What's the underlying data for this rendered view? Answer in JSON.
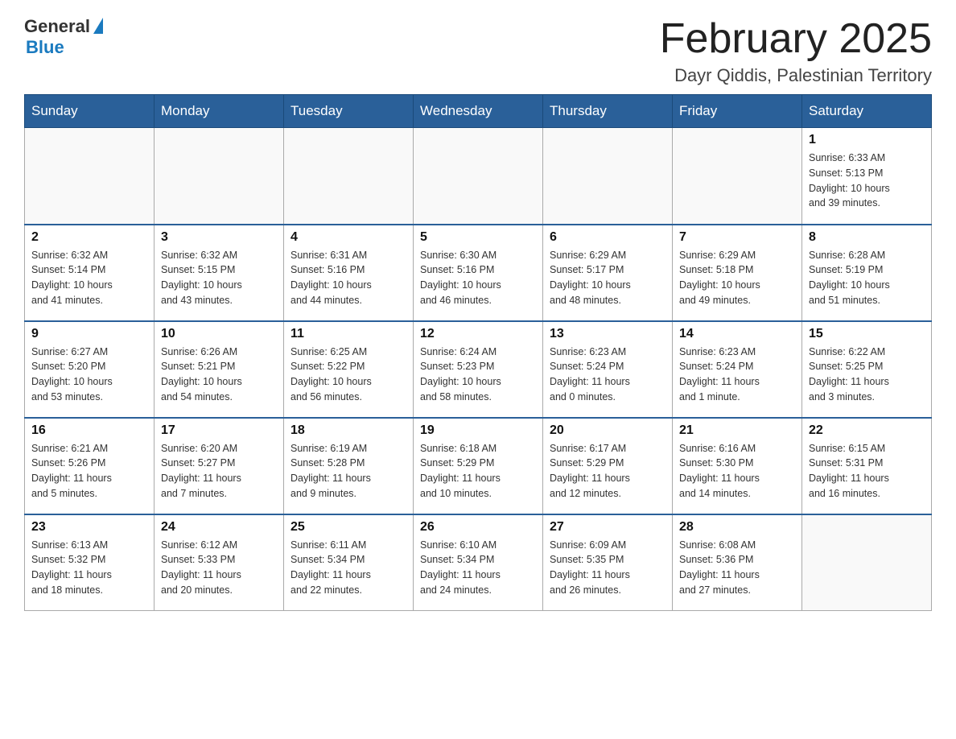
{
  "header": {
    "logo_general": "General",
    "logo_blue": "Blue",
    "month_title": "February 2025",
    "location": "Dayr Qiddis, Palestinian Territory"
  },
  "columns": [
    "Sunday",
    "Monday",
    "Tuesday",
    "Wednesday",
    "Thursday",
    "Friday",
    "Saturday"
  ],
  "weeks": [
    {
      "days": [
        {
          "number": "",
          "info": ""
        },
        {
          "number": "",
          "info": ""
        },
        {
          "number": "",
          "info": ""
        },
        {
          "number": "",
          "info": ""
        },
        {
          "number": "",
          "info": ""
        },
        {
          "number": "",
          "info": ""
        },
        {
          "number": "1",
          "info": "Sunrise: 6:33 AM\nSunset: 5:13 PM\nDaylight: 10 hours\nand 39 minutes."
        }
      ]
    },
    {
      "days": [
        {
          "number": "2",
          "info": "Sunrise: 6:32 AM\nSunset: 5:14 PM\nDaylight: 10 hours\nand 41 minutes."
        },
        {
          "number": "3",
          "info": "Sunrise: 6:32 AM\nSunset: 5:15 PM\nDaylight: 10 hours\nand 43 minutes."
        },
        {
          "number": "4",
          "info": "Sunrise: 6:31 AM\nSunset: 5:16 PM\nDaylight: 10 hours\nand 44 minutes."
        },
        {
          "number": "5",
          "info": "Sunrise: 6:30 AM\nSunset: 5:16 PM\nDaylight: 10 hours\nand 46 minutes."
        },
        {
          "number": "6",
          "info": "Sunrise: 6:29 AM\nSunset: 5:17 PM\nDaylight: 10 hours\nand 48 minutes."
        },
        {
          "number": "7",
          "info": "Sunrise: 6:29 AM\nSunset: 5:18 PM\nDaylight: 10 hours\nand 49 minutes."
        },
        {
          "number": "8",
          "info": "Sunrise: 6:28 AM\nSunset: 5:19 PM\nDaylight: 10 hours\nand 51 minutes."
        }
      ]
    },
    {
      "days": [
        {
          "number": "9",
          "info": "Sunrise: 6:27 AM\nSunset: 5:20 PM\nDaylight: 10 hours\nand 53 minutes."
        },
        {
          "number": "10",
          "info": "Sunrise: 6:26 AM\nSunset: 5:21 PM\nDaylight: 10 hours\nand 54 minutes."
        },
        {
          "number": "11",
          "info": "Sunrise: 6:25 AM\nSunset: 5:22 PM\nDaylight: 10 hours\nand 56 minutes."
        },
        {
          "number": "12",
          "info": "Sunrise: 6:24 AM\nSunset: 5:23 PM\nDaylight: 10 hours\nand 58 minutes."
        },
        {
          "number": "13",
          "info": "Sunrise: 6:23 AM\nSunset: 5:24 PM\nDaylight: 11 hours\nand 0 minutes."
        },
        {
          "number": "14",
          "info": "Sunrise: 6:23 AM\nSunset: 5:24 PM\nDaylight: 11 hours\nand 1 minute."
        },
        {
          "number": "15",
          "info": "Sunrise: 6:22 AM\nSunset: 5:25 PM\nDaylight: 11 hours\nand 3 minutes."
        }
      ]
    },
    {
      "days": [
        {
          "number": "16",
          "info": "Sunrise: 6:21 AM\nSunset: 5:26 PM\nDaylight: 11 hours\nand 5 minutes."
        },
        {
          "number": "17",
          "info": "Sunrise: 6:20 AM\nSunset: 5:27 PM\nDaylight: 11 hours\nand 7 minutes."
        },
        {
          "number": "18",
          "info": "Sunrise: 6:19 AM\nSunset: 5:28 PM\nDaylight: 11 hours\nand 9 minutes."
        },
        {
          "number": "19",
          "info": "Sunrise: 6:18 AM\nSunset: 5:29 PM\nDaylight: 11 hours\nand 10 minutes."
        },
        {
          "number": "20",
          "info": "Sunrise: 6:17 AM\nSunset: 5:29 PM\nDaylight: 11 hours\nand 12 minutes."
        },
        {
          "number": "21",
          "info": "Sunrise: 6:16 AM\nSunset: 5:30 PM\nDaylight: 11 hours\nand 14 minutes."
        },
        {
          "number": "22",
          "info": "Sunrise: 6:15 AM\nSunset: 5:31 PM\nDaylight: 11 hours\nand 16 minutes."
        }
      ]
    },
    {
      "days": [
        {
          "number": "23",
          "info": "Sunrise: 6:13 AM\nSunset: 5:32 PM\nDaylight: 11 hours\nand 18 minutes."
        },
        {
          "number": "24",
          "info": "Sunrise: 6:12 AM\nSunset: 5:33 PM\nDaylight: 11 hours\nand 20 minutes."
        },
        {
          "number": "25",
          "info": "Sunrise: 6:11 AM\nSunset: 5:34 PM\nDaylight: 11 hours\nand 22 minutes."
        },
        {
          "number": "26",
          "info": "Sunrise: 6:10 AM\nSunset: 5:34 PM\nDaylight: 11 hours\nand 24 minutes."
        },
        {
          "number": "27",
          "info": "Sunrise: 6:09 AM\nSunset: 5:35 PM\nDaylight: 11 hours\nand 26 minutes."
        },
        {
          "number": "28",
          "info": "Sunrise: 6:08 AM\nSunset: 5:36 PM\nDaylight: 11 hours\nand 27 minutes."
        },
        {
          "number": "",
          "info": ""
        }
      ]
    }
  ]
}
